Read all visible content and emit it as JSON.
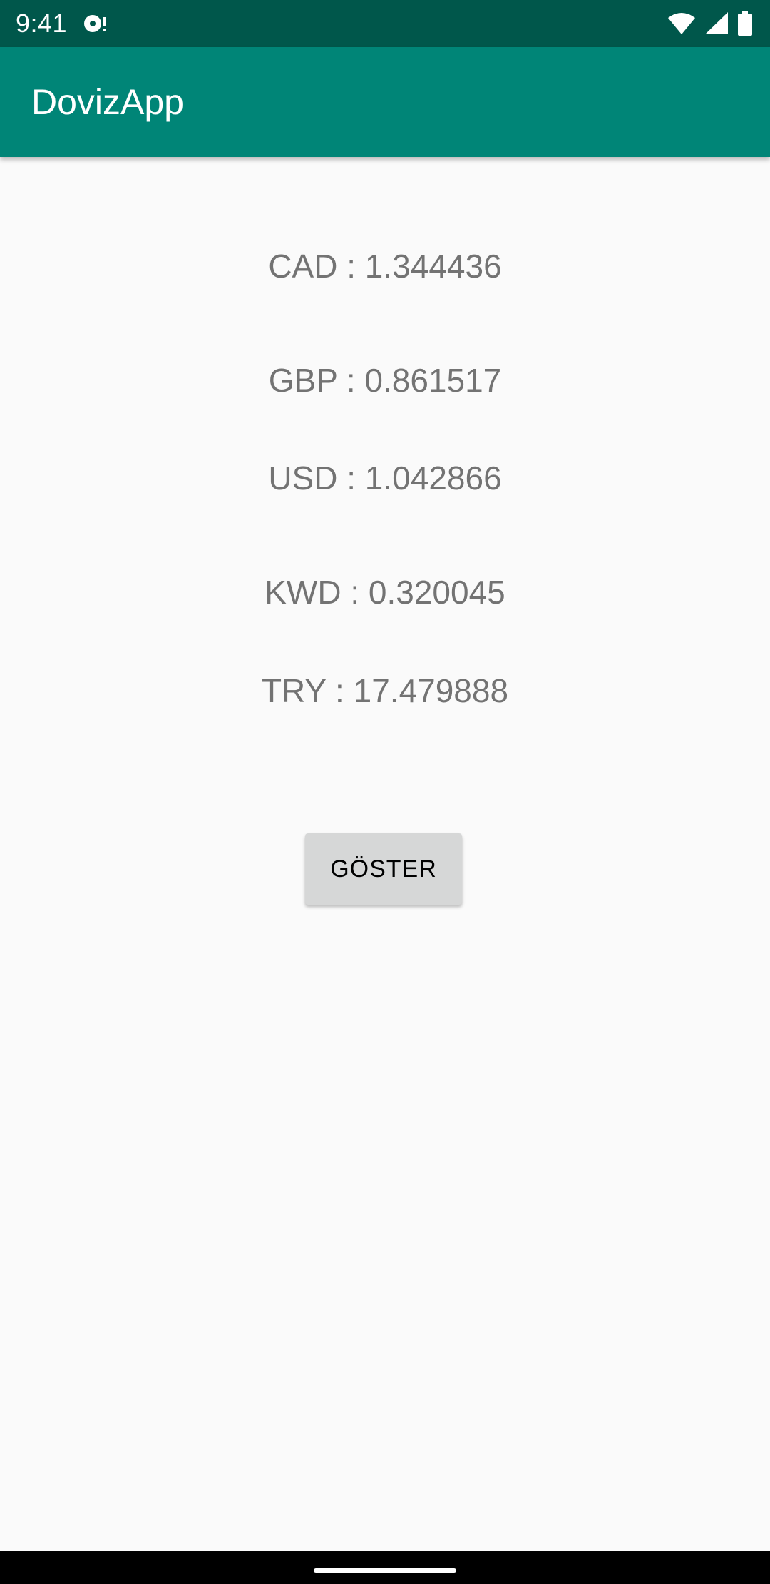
{
  "status_bar": {
    "time": "9:41",
    "icons": [
      "media-icon",
      "wifi-icon",
      "signal-icon",
      "battery-icon"
    ],
    "background_color": "#00574b"
  },
  "app_bar": {
    "title": "DovizApp",
    "background_color": "#008577"
  },
  "rates": [
    {
      "text": "CAD : 1.344436"
    },
    {
      "text": "GBP : 0.861517"
    },
    {
      "text": "USD : 1.042866"
    },
    {
      "text": "KWD : 0.320045"
    },
    {
      "text": "TRY : 17.479888"
    }
  ],
  "show_button": {
    "label": "GÖSTER"
  },
  "navigation": {
    "handle": "home-handle"
  }
}
